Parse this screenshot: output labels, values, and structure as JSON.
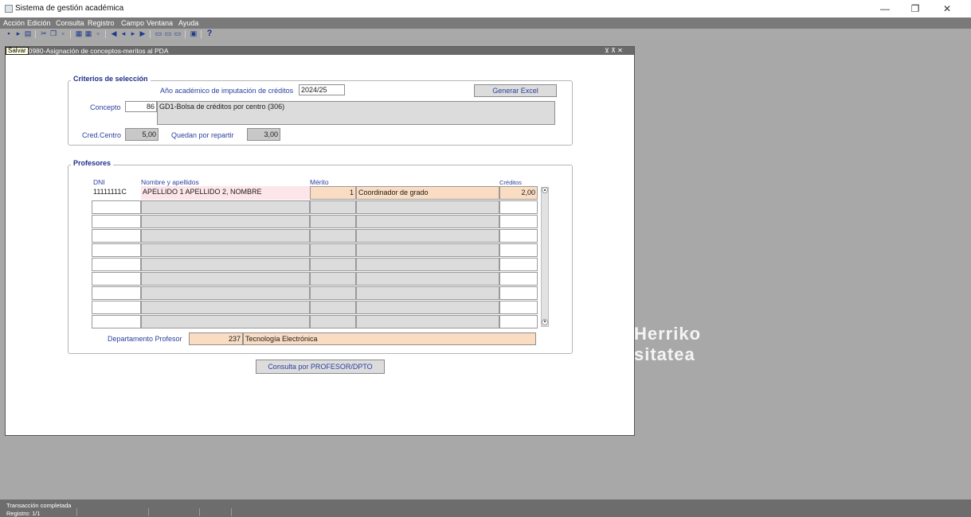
{
  "window": {
    "title": "Sistema de gestión académica",
    "controls": {
      "minimize": "—",
      "maximize": "❐",
      "close": "✕"
    }
  },
  "menu": [
    "Acción",
    "Edición",
    "Consulta",
    "Registro",
    "Campo",
    "Ventana",
    "Ayuda"
  ],
  "toolbar": {
    "help": "?"
  },
  "background": {
    "logo_line1": "Herriko",
    "logo_line2": "sitatea"
  },
  "form": {
    "tooltip": "Salvar",
    "title": "n0980-Asignación de conceptos-meritos al PDA",
    "controls": "⊻ ⊼ ✕",
    "criterios": {
      "label": "Criterios de selección",
      "anio_label": "Año académico de imputación de créditos",
      "anio_value": "2024/25",
      "excel_button": "Generar Excel",
      "concepto_label": "Concepto",
      "concepto_code": "86",
      "concepto_desc": "GD1-Bolsa de créditos por centro (306)",
      "cred_centro_label": "Cred.Centro",
      "cred_centro_value": "5,00",
      "quedan_label": "Quedan por repartir",
      "quedan_value": "3,00"
    },
    "profesores": {
      "label": "Profesores",
      "columns": {
        "dni": "DNI",
        "nombre": "Nombre y apellidos",
        "merito": "Mérito",
        "creditos": "Créditos"
      },
      "rows": [
        {
          "dni": "11111111C",
          "nombre": "APELLIDO 1 APELLIDO 2, NOMBRE",
          "merito_num": "1",
          "merito_desc": "Coordinador de grado",
          "creditos": "2,00"
        },
        {
          "dni": "",
          "nombre": "",
          "merito_num": "",
          "merito_desc": "",
          "creditos": ""
        },
        {
          "dni": "",
          "nombre": "",
          "merito_num": "",
          "merito_desc": "",
          "creditos": ""
        },
        {
          "dni": "",
          "nombre": "",
          "merito_num": "",
          "merito_desc": "",
          "creditos": ""
        },
        {
          "dni": "",
          "nombre": "",
          "merito_num": "",
          "merito_desc": "",
          "creditos": ""
        },
        {
          "dni": "",
          "nombre": "",
          "merito_num": "",
          "merito_desc": "",
          "creditos": ""
        },
        {
          "dni": "",
          "nombre": "",
          "merito_num": "",
          "merito_desc": "",
          "creditos": ""
        },
        {
          "dni": "",
          "nombre": "",
          "merito_num": "",
          "merito_desc": "",
          "creditos": ""
        },
        {
          "dni": "",
          "nombre": "",
          "merito_num": "",
          "merito_desc": "",
          "creditos": ""
        },
        {
          "dni": "",
          "nombre": "",
          "merito_num": "",
          "merito_desc": "",
          "creditos": ""
        }
      ],
      "depto_label": "Departamento Profesor",
      "depto_code": "237",
      "depto_name": "Tecnología Electrónica"
    },
    "consulta_button": "Consulta por PROFESOR/DPTO"
  },
  "status": {
    "message": "Transacción completada",
    "record": "Registro: 1/1"
  }
}
